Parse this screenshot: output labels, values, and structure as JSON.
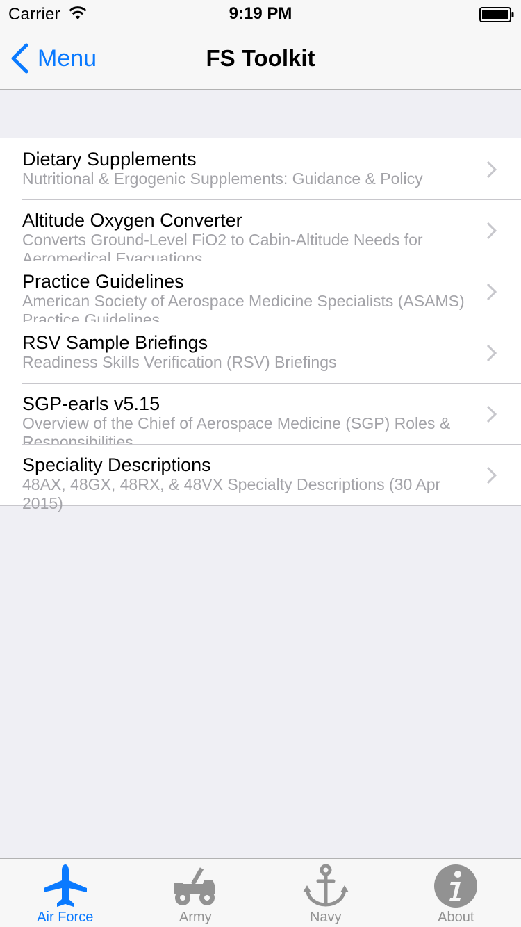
{
  "status_bar": {
    "carrier": "Carrier",
    "time": "9:19 PM"
  },
  "nav": {
    "back_label": "Menu",
    "title": "FS Toolkit"
  },
  "list": [
    {
      "title": "Dietary Supplements",
      "subtitle": "Nutritional & Ergogenic Supplements: Guidance & Policy"
    },
    {
      "title": "Altitude Oxygen Converter",
      "subtitle": "Converts Ground-Level FiO2 to Cabin-Altitude Needs for Aeromedical Evacuations"
    },
    {
      "title": "Practice Guidelines",
      "subtitle": "American Society of Aerospace Medicine Specialists (ASAMS) Practice Guidelines"
    },
    {
      "title": "RSV Sample Briefings",
      "subtitle": "Readiness Skills Verification (RSV) Briefings"
    },
    {
      "title": "SGP-earls v5.15",
      "subtitle": "Overview of the Chief of Aerospace Medicine (SGP) Roles & Responsibilities"
    },
    {
      "title": "Speciality Descriptions",
      "subtitle": "48AX, 48GX, 48RX, & 48VX Specialty Descriptions (30 Apr 2015)"
    }
  ],
  "tabs": [
    {
      "label": "Air Force",
      "icon": "airplane-icon",
      "active": true
    },
    {
      "label": "Army",
      "icon": "jeep-icon",
      "active": false
    },
    {
      "label": "Navy",
      "icon": "anchor-icon",
      "active": false
    },
    {
      "label": "About",
      "icon": "info-icon",
      "active": false
    }
  ],
  "colors": {
    "accent": "#0a7aff",
    "inactive_tab": "#929292",
    "subtitle": "#a3a3a8",
    "background": "#efeff4"
  }
}
